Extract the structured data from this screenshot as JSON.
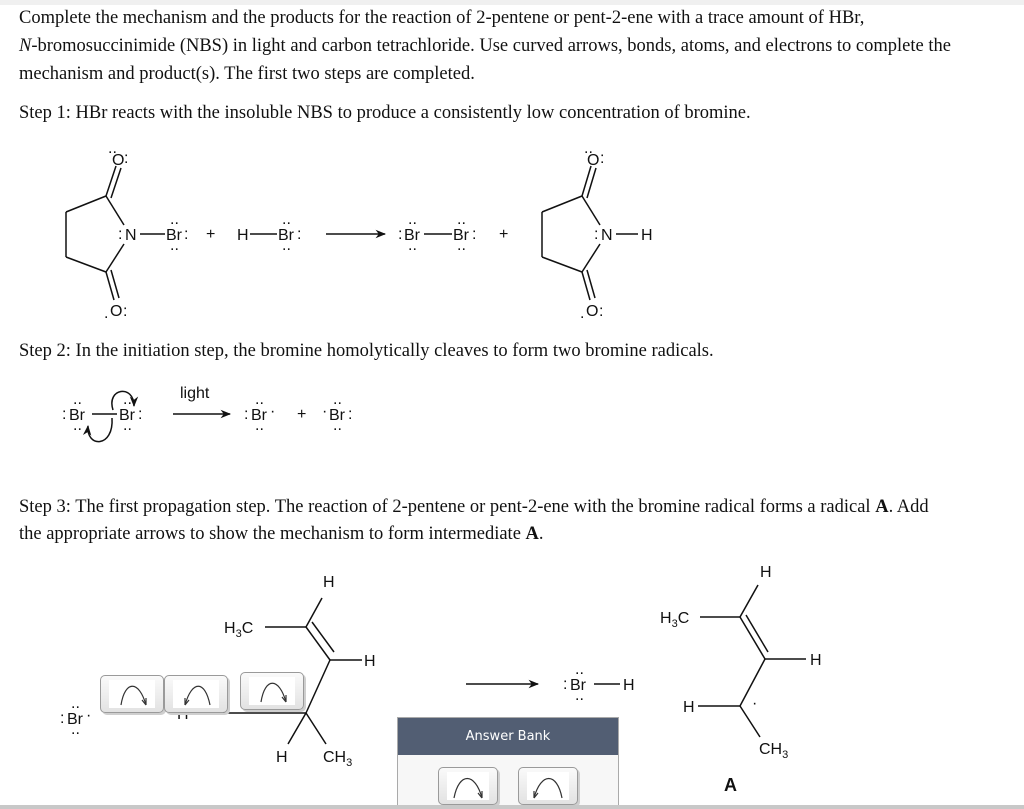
{
  "intro": {
    "line1": "Complete the mechanism and the products for the reaction of 2-pentene or pent-2-ene with a trace amount of HBr,",
    "line2_italic": "N",
    "line2_rest": "-bromosuccinimide (NBS) in light and carbon tetrachloride. Use curved arrows, bonds, atoms, and electrons to complete the",
    "line3": "mechanism and product(s). The first two steps are completed."
  },
  "step1": {
    "text": "Step 1: HBr reacts with the insoluble NBS to produce a consistently low concentration of bromine.",
    "atoms": {
      "O": "O",
      "N": "N",
      "Br": "Br",
      "H": "H",
      "plus": "+"
    }
  },
  "step2": {
    "text": "Step 2: In the initiation step, the bromine homolytically cleaves to form two bromine radicals.",
    "condition": "light",
    "atoms": {
      "Br": "Br",
      "plus": "+"
    }
  },
  "step3": {
    "text_line1_a": "Step 3: The first propagation step. The reaction of 2-pentene or pent-2-ene with the bromine radical forms a radical ",
    "text_line1_bold": "A",
    "text_line1_b": ". Add",
    "text_line2_a": "the appropriate arrows to show the mechanism to form intermediate ",
    "text_line2_bold": "A",
    "text_line2_b": ".",
    "reactant": {
      "Br": "Br",
      "H": "H",
      "H3C_main": "H",
      "H3C_sub": "3",
      "H3C_tail": "C",
      "CH3_main": "CH",
      "CH3_sub": "3"
    },
    "placed_arrows": [
      {
        "type": "curved-arrow-right"
      },
      {
        "type": "curved-arrow-left"
      },
      {
        "type": "curved-arrow-right"
      }
    ],
    "product_HBr": {
      "Br": "Br",
      "H": "H"
    },
    "intermediate_label": "A"
  },
  "answer_bank": {
    "title": "Answer Bank",
    "items": [
      {
        "type": "curved-arrow-right"
      },
      {
        "type": "curved-arrow-left"
      }
    ]
  },
  "colors": {
    "answer_bank_header": "#525e73",
    "text": "#111111"
  }
}
